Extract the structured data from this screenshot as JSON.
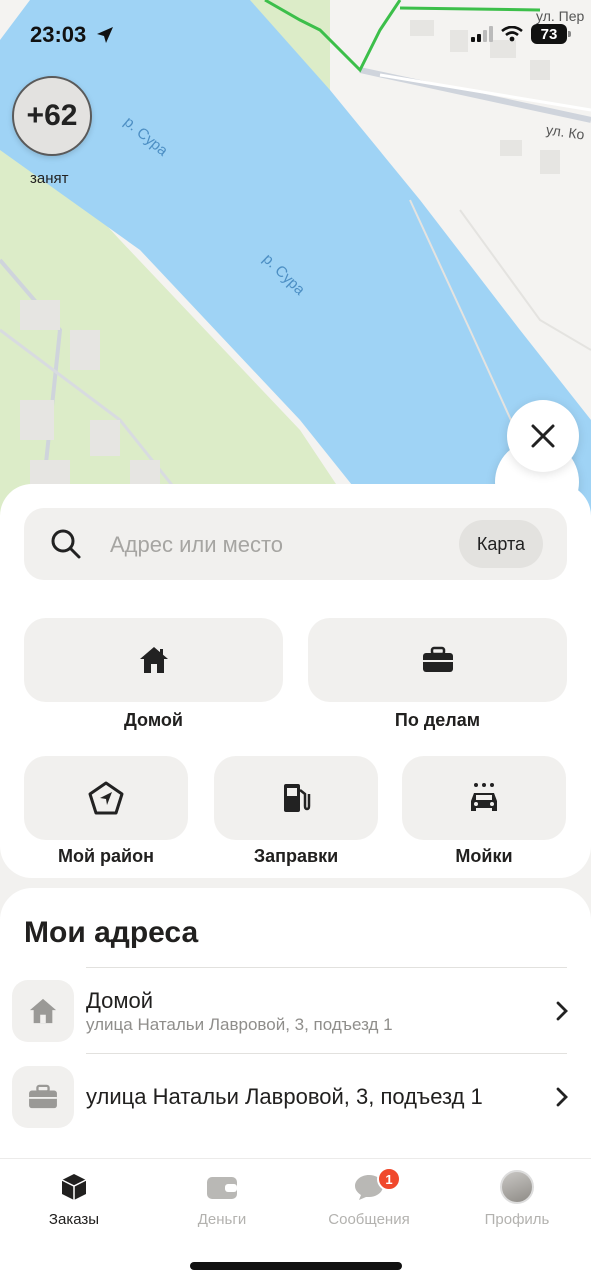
{
  "status_bar": {
    "time": "23:03",
    "battery": "73"
  },
  "map": {
    "rating": "+62",
    "status": "занят",
    "river_label": "р. Сура",
    "street_1": "ул. Пер",
    "street_2": "ул. Ко"
  },
  "search": {
    "placeholder": "Адрес или место",
    "map_button": "Карта"
  },
  "quick": {
    "home": "Домой",
    "business": "По делам",
    "district": "Мой район",
    "gas": "Заправки",
    "wash": "Мойки"
  },
  "addresses": {
    "title": "Мои адреса",
    "items": [
      {
        "name": "Домой",
        "sub": "улица Натальи Лавровой, 3, подъезд 1",
        "icon": "home-icon"
      },
      {
        "name": "улица Натальи Лавровой, 3, подъезд 1",
        "icon": "briefcase-icon"
      }
    ]
  },
  "tabs": {
    "orders": "Заказы",
    "money": "Деньги",
    "messages": "Сообщения",
    "messages_badge": "1",
    "profile": "Профиль"
  },
  "colors": {
    "river": "#9fd3f5",
    "park": "#d8ebc3",
    "accent_badge": "#f0482c",
    "route": "#3cbf4a"
  }
}
